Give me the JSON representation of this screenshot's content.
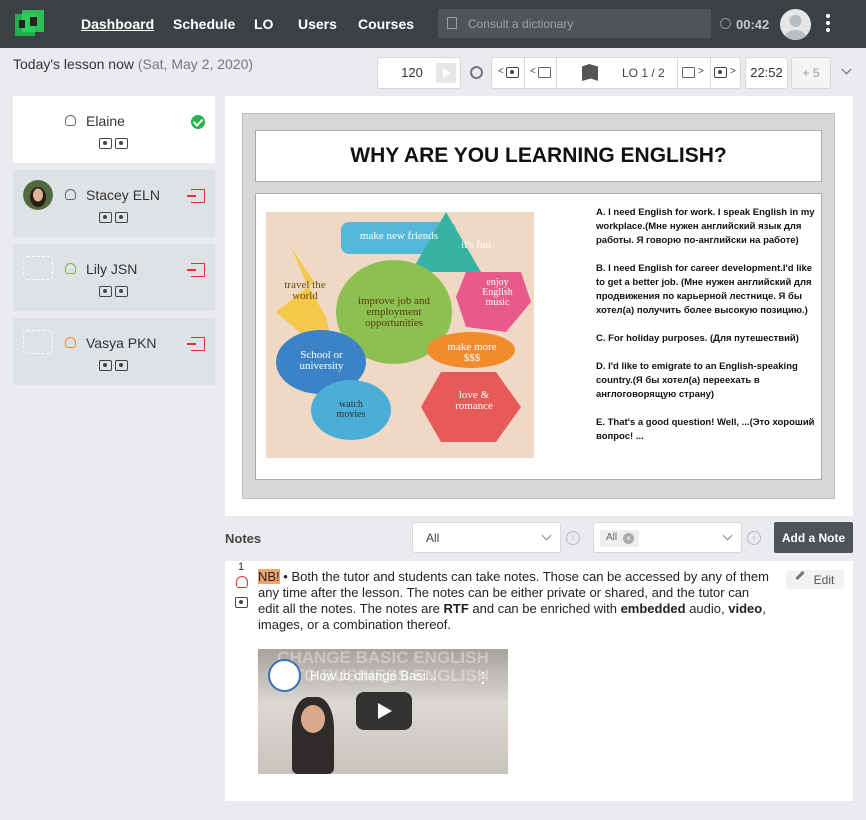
{
  "nav": {
    "items": [
      "Dashboard",
      "Schedule",
      "LO",
      "Users",
      "Courses"
    ],
    "active": "Dashboard",
    "dictionary_placeholder": "Consult a dictionary",
    "timer": "00:42"
  },
  "lesson": {
    "title": "Today's lesson now",
    "date": "(Sat, May 2, 2020)",
    "duration_value": "120",
    "lo_indicator": "LO 1 / 2",
    "end_time": "22:52",
    "plus_label": "+ 5"
  },
  "students": [
    {
      "name": "Elaine",
      "status": "present",
      "selected": true
    },
    {
      "name": "Stacey ELN",
      "status": "exit"
    },
    {
      "name": "Lily JSN",
      "status": "exit"
    },
    {
      "name": "Vasya PKN",
      "status": "exit"
    }
  ],
  "slide": {
    "title": "WHY ARE YOU LEARNING ENGLISH?",
    "image_bubbles": [
      "make new friends",
      "it's fun",
      "travel the world",
      "improve job and employment opportunities",
      "enjoy English music",
      "School or university",
      "make more $$$",
      "watch movies",
      "love & romance"
    ],
    "answers": [
      "A. I need English for work. I speak English in my workplace.(Мне нужен английский язык для работы. Я говорю по-английски на работе)",
      "B. I need English for career development.I'd like to get a better job. (Мне нужен английский для продвижения по карьерной лестнице. Я бы хотел(а)  получить более высокую позицию.)",
      "C. For holiday purposes. (Для путешествий)",
      "D. I'd like to emigrate to an English-speaking country.(Я бы хотел(а) переехать в англоговорящую страну)",
      "E. That's a good question! Well, ...(Это хороший вопрос! ..."
    ]
  },
  "notes": {
    "label": "Notes",
    "filter_value": "All",
    "tag_value": "All",
    "add_button": "Add a Note",
    "items": [
      {
        "number": "1",
        "nb": "NB!",
        "text_parts": [
          "• Both the tutor and students can take notes. Those can be accessed by any of them any time after the lesson. The notes can be either private or shared, and the tutor can edit all the notes. The notes are ",
          "RTF",
          " and can be enriched with ",
          "embedded",
          " audio, ",
          "video",
          ",\nimages, or a combination thereof."
        ],
        "edit_label": "Edit",
        "video_title": "How to change Basi..."
      }
    ]
  },
  "colors": {
    "topbar": "#3b4043",
    "present": "#27b44a",
    "exit": "#dd3333",
    "nb_highlight": "#f0a46a"
  }
}
